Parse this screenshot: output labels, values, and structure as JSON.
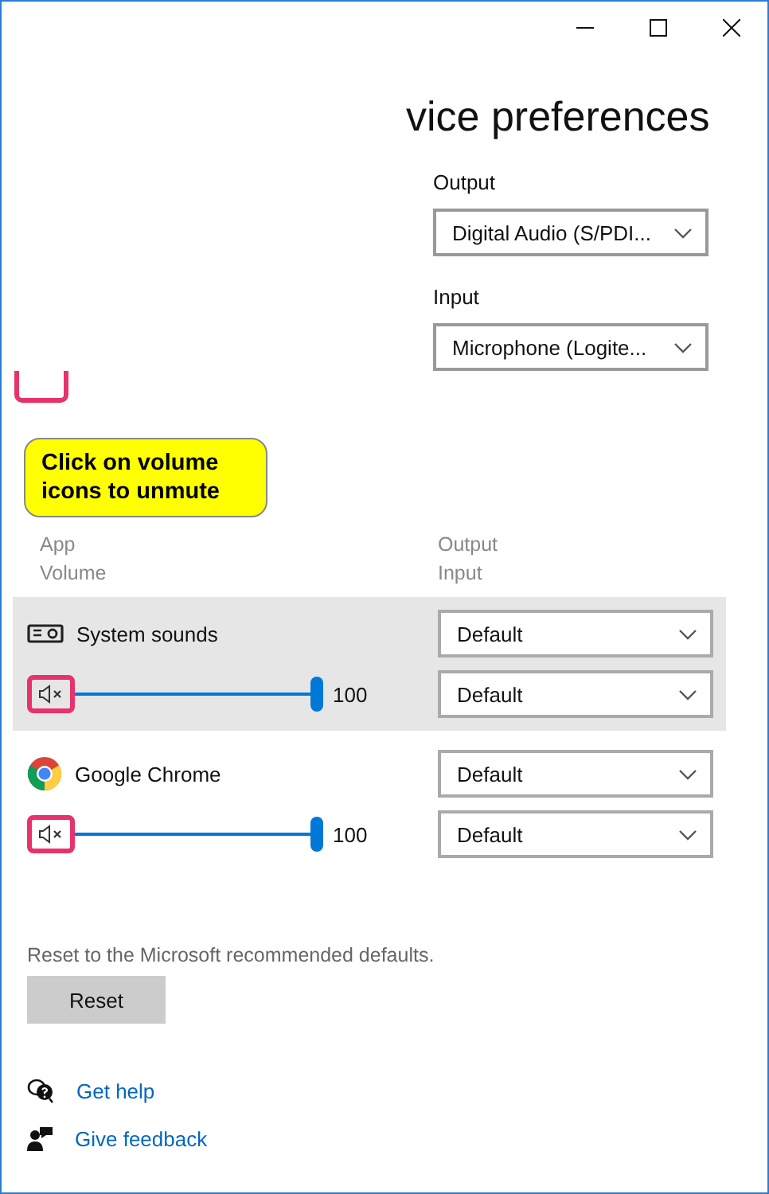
{
  "title": "vice preferences",
  "devices": [
    {
      "label": "Output",
      "value": "Digital Audio (S/PDI..."
    },
    {
      "label": "Input",
      "value": "Microphone (Logite..."
    }
  ],
  "callout": {
    "text": "Click on volume icons to unmute"
  },
  "columns": {
    "left": [
      "App",
      "Volume"
    ],
    "right": [
      "Output",
      "Input"
    ]
  },
  "apps": [
    {
      "name": "System sounds",
      "kind": "system",
      "selected": true,
      "muted": true,
      "highlighted": true,
      "level": 1,
      "reading": "100",
      "output": "Default",
      "input": "Default"
    },
    {
      "name": "Google Chrome",
      "kind": "browser",
      "selected": false,
      "muted": true,
      "highlighted": true,
      "level": 1,
      "reading": "100",
      "output": "Default",
      "input": "Default"
    }
  ],
  "reset": {
    "text": "Reset to the Microsoft recommended defaults.",
    "button": "Reset"
  },
  "links": [
    {
      "kind": "help",
      "label": "Get help"
    },
    {
      "kind": "feedback",
      "label": "Give feedback"
    }
  ]
}
